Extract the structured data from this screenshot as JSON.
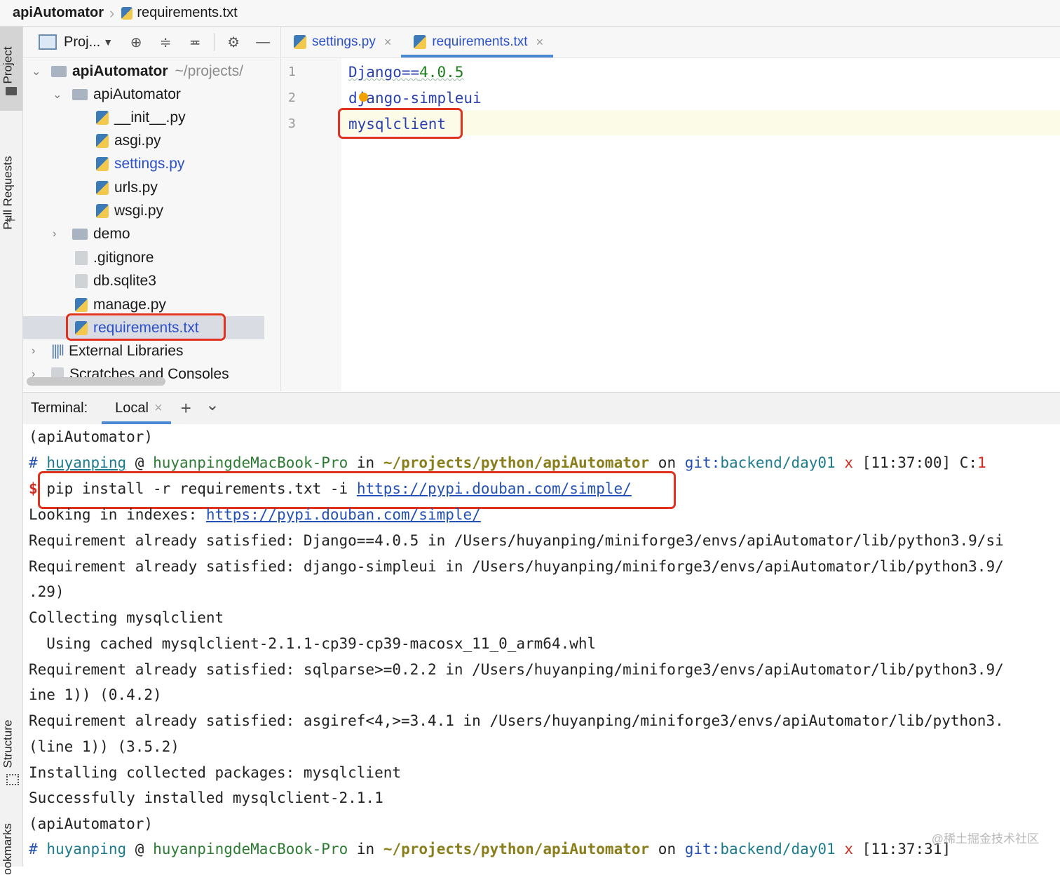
{
  "breadcrumb": {
    "root": "apiAutomator",
    "file": "requirements.txt"
  },
  "tool_stripe": {
    "project": "Project",
    "pull_requests": "Pull Requests",
    "structure": "Structure",
    "bookmarks": "ookmarks"
  },
  "project_panel": {
    "view_label": "Proj...",
    "tree": {
      "root": {
        "name": "apiAutomator",
        "path": "~/projects/"
      },
      "package": "apiAutomator",
      "files": [
        "__init__.py",
        "asgi.py",
        "settings.py",
        "urls.py",
        "wsgi.py"
      ],
      "demo": "demo",
      "gitignore": ".gitignore",
      "db": "db.sqlite3",
      "manage": "manage.py",
      "requirements": "requirements.txt",
      "external": "External Libraries",
      "scratches": "Scratches and Consoles"
    }
  },
  "editor": {
    "tabs": [
      {
        "label": "settings.py",
        "close": "×"
      },
      {
        "label": "requirements.txt",
        "close": "×"
      }
    ],
    "line_numbers": [
      "1",
      "2",
      "3"
    ],
    "lines": {
      "l1_name": "Django==",
      "l1_ver": "4.0.5",
      "l2_a": "d",
      "l2_b": "jango-simpleui",
      "l3": "mysqlclient"
    }
  },
  "terminal": {
    "title": "Terminal:",
    "tab_label": "Local",
    "tab_close": "×",
    "add": "+",
    "dropdown": "⌄",
    "prompt1": {
      "hash": "#",
      "user": "huyanping",
      "at": "@",
      "host": "huyanpingdeMacBook-Pro",
      "in": "in",
      "path": "~/projects/python/apiAutomator",
      "on": "on",
      "git": "git:",
      "branch": "backend/day01",
      "x": "x",
      "time": "[11:37:00]",
      "c": "C:",
      "code": "1"
    },
    "dollar": "$",
    "command": "pip install -r requirements.txt -i ",
    "command_url": "https://pypi.douban.com/simple/",
    "env_line": "(apiAutomator)",
    "looking": "Looking in indexes: ",
    "looking_url": "https://pypi.douban.com/simple/",
    "out": [
      "Requirement already satisfied: Django==4.0.5 in /Users/huyanping/miniforge3/envs/apiAutomator/lib/python3.9/si",
      "Requirement already satisfied: django-simpleui in /Users/huyanping/miniforge3/envs/apiAutomator/lib/python3.9/",
      ".29)",
      "Collecting mysqlclient",
      "  Using cached mysqlclient-2.1.1-cp39-cp39-macosx_11_0_arm64.whl",
      "Requirement already satisfied: sqlparse>=0.2.2 in /Users/huyanping/miniforge3/envs/apiAutomator/lib/python3.9/",
      "ine 1)) (0.4.2)",
      "Requirement already satisfied: asgiref<4,>=3.4.1 in /Users/huyanping/miniforge3/envs/apiAutomator/lib/python3.",
      "(line 1)) (3.5.2)",
      "Installing collected packages: mysqlclient",
      "Successfully installed mysqlclient-2.1.1"
    ],
    "env_line2": "(apiAutomator)",
    "prompt2_time": "[11:37:31]"
  },
  "watermark": "@稀土掘金技术社区",
  "colors": {
    "accent": "#4a88d6",
    "highlight_box": "#e0321e"
  }
}
